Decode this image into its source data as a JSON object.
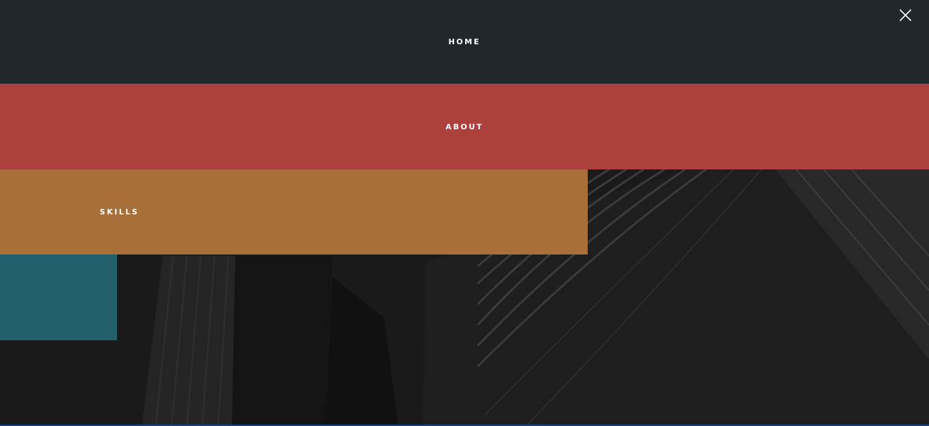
{
  "menu": {
    "items": [
      {
        "label": "HOME",
        "color": "#22272b"
      },
      {
        "label": "ABOUT",
        "color": "#ab403d"
      },
      {
        "label": "SKILLS",
        "color": "#a96f39"
      },
      {
        "label": "",
        "color": "#23606b"
      }
    ],
    "close_icon": "close-icon"
  },
  "background": {
    "image": "skyscrapers-photo",
    "tone": "dark-grayscale"
  }
}
